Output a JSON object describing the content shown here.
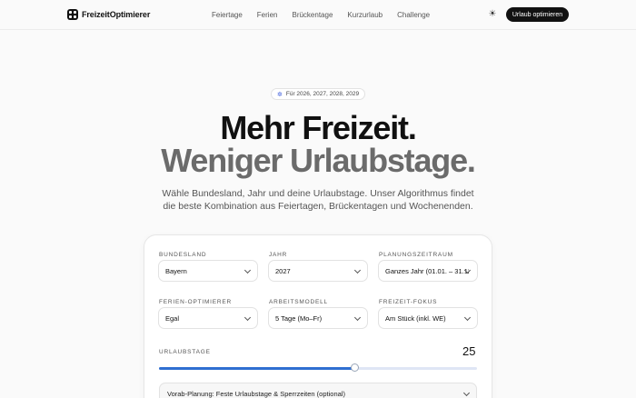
{
  "brand": {
    "name": "FreizeitOptimierer"
  },
  "nav": {
    "links": [
      "Feiertage",
      "Ferien",
      "Brückentage",
      "Kurzurlaub",
      "Challenge"
    ],
    "cta": "Urlaub optimieren"
  },
  "hero": {
    "pill": "Für 2026, 2027, 2028, 2029",
    "title_line1": "Mehr Freizeit.",
    "title_line2": "Weniger Urlaubstage.",
    "subtitle": "Wähle Bundesland, Jahr und deine Urlaubstage. Unser Algorithmus findet die beste Kombination aus Feiertagen, Brückentagen und Wochenenden."
  },
  "form": {
    "bundesland": {
      "label": "BUNDESLAND",
      "value": "Bayern"
    },
    "jahr": {
      "label": "JAHR",
      "value": "2027"
    },
    "zeitraum": {
      "label": "PLANUNGSZEITRAUM",
      "value": "Ganzes Jahr (01.01. – 31.12.)"
    },
    "optimierer": {
      "label": "FERIEN-OPTIMIERER",
      "value": "Egal"
    },
    "modell": {
      "label": "ARBEITSMODELL",
      "value": "5 Tage (Mo–Fr)"
    },
    "fokus": {
      "label": "FREIZEIT-FOKUS",
      "value": "Am Stück (inkl. WE)"
    },
    "urlaubstage": {
      "label": "URLAUBSTAGE",
      "value": "25",
      "slider_fraction": 0.615
    },
    "vorab": "Vorab-Planung: Feste Urlaubstage & Sperrzeiten (optional)"
  },
  "colors": {
    "accent": "#2f6fd1",
    "primary": "#111111"
  },
  "icons": {
    "logo": "logo-icon",
    "theme": "sun-icon",
    "pill": "sparkle-icon",
    "select": "chevron-down-icon"
  }
}
